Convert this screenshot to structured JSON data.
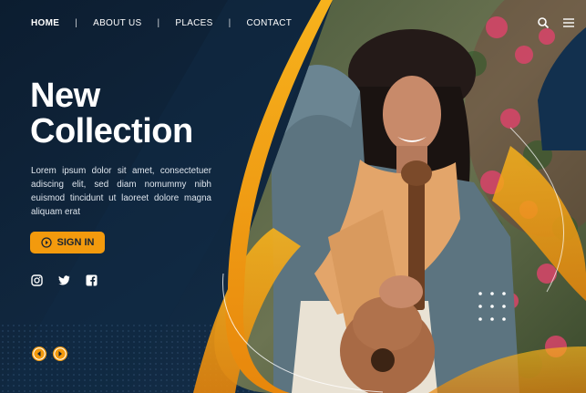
{
  "nav": {
    "home": "HOME",
    "separator": "|",
    "about": "ABOUT US",
    "places": "PLACES",
    "contact": "CONTACT"
  },
  "hero": {
    "title_line1": "New",
    "title_line2": "Collection",
    "body": "Lorem ipsum dolor sit amet, consectetuer adiscing elit, sed diam nomummy nibh euismod tincidunt ut laoreet dolore magna aliquam erat",
    "signin_label": "SIGN IN"
  },
  "icons": {
    "search": "search-icon",
    "menu": "hamburger-menu-icon",
    "signin": "play-circle-icon",
    "instagram": "instagram-icon",
    "twitter": "twitter-icon",
    "facebook": "facebook-icon",
    "prev": "chevron-left-icon",
    "next": "chevron-right-icon"
  },
  "colors": {
    "background": "#0e2236",
    "accent": "#f39a0d",
    "text": "#ffffff"
  }
}
